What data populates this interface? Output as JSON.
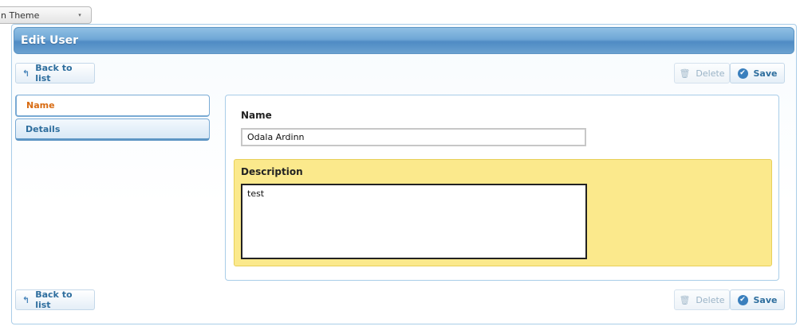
{
  "theme_switcher": {
    "label": "n Theme",
    "arrow": "▾"
  },
  "panel": {
    "title": "Edit User"
  },
  "toolbar_top": {
    "back_label": "Back to list",
    "delete_label": "Delete",
    "save_label": "Save"
  },
  "toolbar_bottom": {
    "back_label": "Back to list",
    "delete_label": "Delete",
    "save_label": "Save"
  },
  "tabs": [
    {
      "label": "Name",
      "active": true
    },
    {
      "label": "Details",
      "active": false
    }
  ],
  "form": {
    "name_label": "Name",
    "name_value": "Odala Ardinn",
    "description_label": "Description",
    "description_value": "test"
  },
  "icons": {
    "back": "↰",
    "delete": "🗑",
    "save": "✔"
  },
  "colors": {
    "header_blue": "#6fa7d6",
    "active_tab_text": "#d86b12",
    "highlight_yellow": "#fbe98c"
  }
}
